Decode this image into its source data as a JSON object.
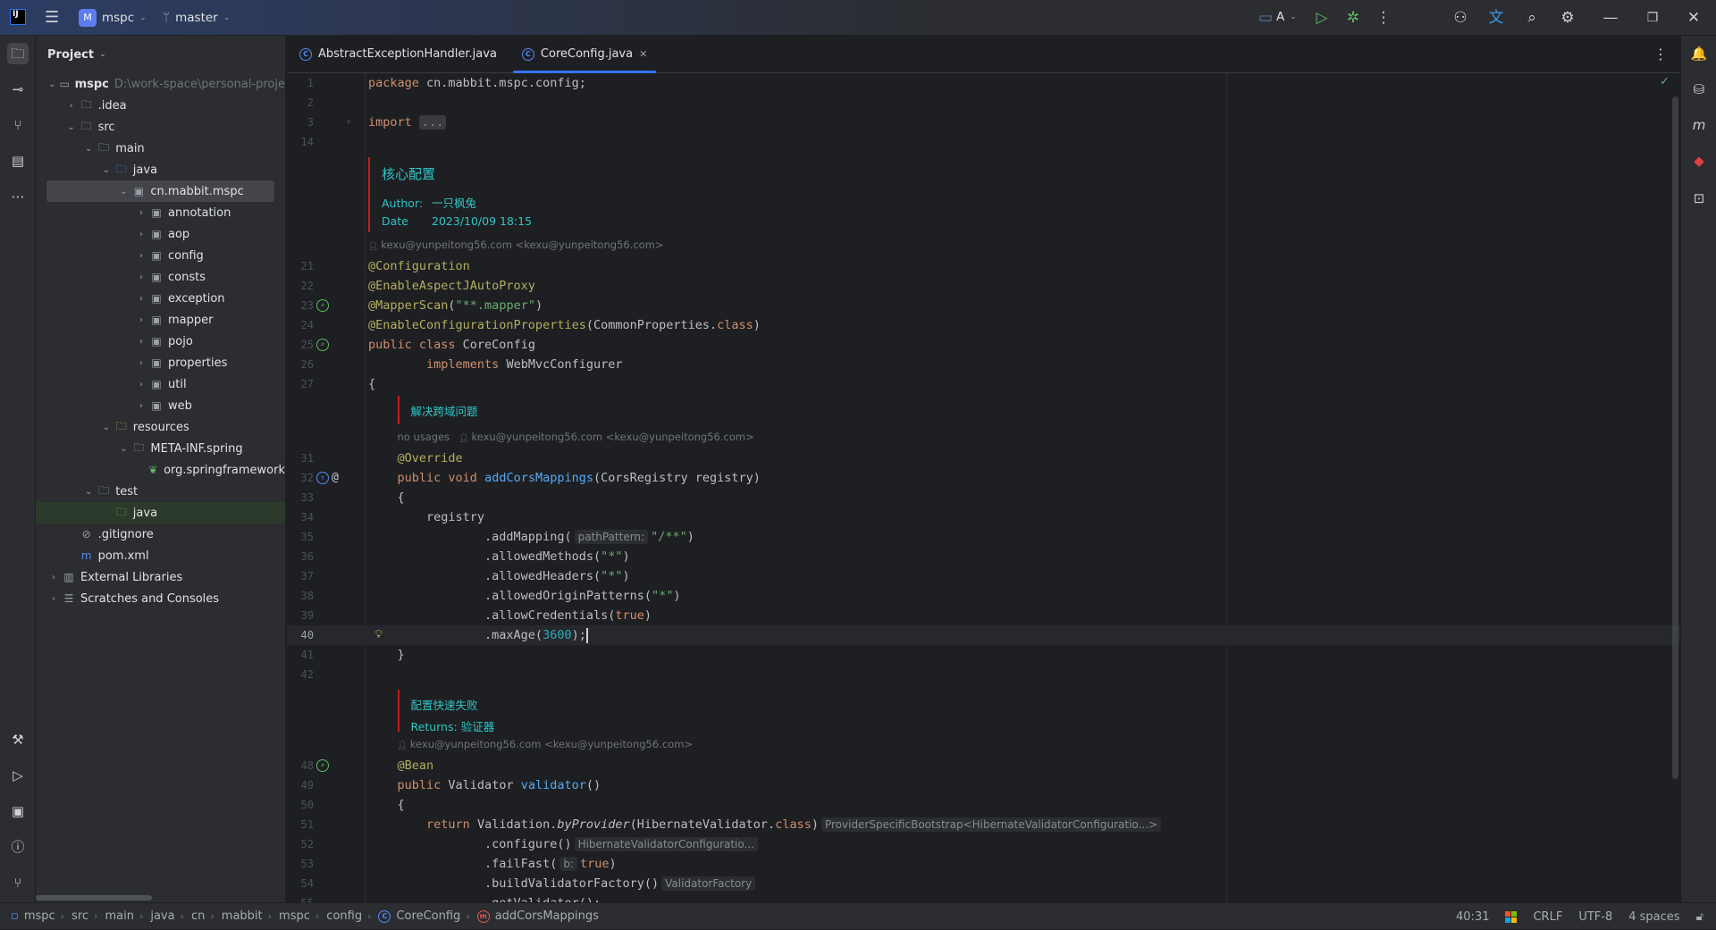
{
  "titlebar": {
    "project": "mspc",
    "project_badge": "M",
    "branch": "master",
    "run_config": "A"
  },
  "project_panel": {
    "title": "Project",
    "tree": [
      {
        "label": "mspc",
        "path": "D:\\work-space\\personal-proje",
        "level": 0,
        "arrow": "down",
        "icon": "module-folder-icon"
      },
      {
        "label": ".idea",
        "level": 1,
        "arrow": "right",
        "icon": "folder-icon"
      },
      {
        "label": "src",
        "level": 1,
        "arrow": "down",
        "icon": "folder-icon"
      },
      {
        "label": "main",
        "level": 2,
        "arrow": "down",
        "icon": "folder-icon"
      },
      {
        "label": "java",
        "level": 3,
        "arrow": "down",
        "icon": "source-folder-icon"
      },
      {
        "label": "cn.mabbit.mspc",
        "level": 4,
        "arrow": "down",
        "icon": "package-icon",
        "selected": true
      },
      {
        "label": "annotation",
        "level": 5,
        "arrow": "right",
        "icon": "package-icon"
      },
      {
        "label": "aop",
        "level": 5,
        "arrow": "right",
        "icon": "package-icon"
      },
      {
        "label": "config",
        "level": 5,
        "arrow": "right",
        "icon": "package-icon"
      },
      {
        "label": "consts",
        "level": 5,
        "arrow": "right",
        "icon": "package-icon"
      },
      {
        "label": "exception",
        "level": 5,
        "arrow": "right",
        "icon": "package-icon"
      },
      {
        "label": "mapper",
        "level": 5,
        "arrow": "right",
        "icon": "package-icon"
      },
      {
        "label": "pojo",
        "level": 5,
        "arrow": "right",
        "icon": "package-icon"
      },
      {
        "label": "properties",
        "level": 5,
        "arrow": "right",
        "icon": "package-icon"
      },
      {
        "label": "util",
        "level": 5,
        "arrow": "right",
        "icon": "package-icon"
      },
      {
        "label": "web",
        "level": 5,
        "arrow": "right",
        "icon": "package-icon"
      },
      {
        "label": "resources",
        "level": 3,
        "arrow": "down",
        "icon": "resources-folder-icon"
      },
      {
        "label": "META-INF.spring",
        "level": 4,
        "arrow": "down",
        "icon": "folder-icon"
      },
      {
        "label": "org.springframework",
        "level": 5,
        "arrow": "",
        "icon": "spring-file-icon"
      },
      {
        "label": "test",
        "level": 2,
        "arrow": "down",
        "icon": "folder-icon"
      },
      {
        "label": "java",
        "level": 3,
        "arrow": "",
        "icon": "test-folder-icon",
        "green": true
      },
      {
        "label": ".gitignore",
        "level": 1,
        "arrow": "",
        "icon": "ignore-file-icon"
      },
      {
        "label": "pom.xml",
        "level": 1,
        "arrow": "",
        "icon": "maven-icon"
      },
      {
        "label": "External Libraries",
        "level": 0,
        "arrow": "right",
        "icon": "library-icon"
      },
      {
        "label": "Scratches and Consoles",
        "level": 0,
        "arrow": "right",
        "icon": "scratches-icon"
      }
    ]
  },
  "tabs": [
    {
      "label": "AbstractExceptionHandler.java",
      "active": false
    },
    {
      "label": "CoreConfig.java",
      "active": true
    }
  ],
  "editor": {
    "rows": [
      {
        "type": "code",
        "n": "1",
        "tokens": [
          [
            "k",
            "package"
          ],
          [
            "t",
            " cn.mabbit.mspc.config;"
          ]
        ]
      },
      {
        "type": "code",
        "n": "2",
        "tokens": []
      },
      {
        "type": "code",
        "n": "3",
        "fold": true,
        "tokens": [
          [
            "k",
            "import "
          ],
          [
            "fold",
            "..."
          ]
        ]
      },
      {
        "type": "code",
        "n": "14",
        "tokens": []
      },
      {
        "type": "doc",
        "indent": 0,
        "height": 92,
        "title": "核心配置",
        "lines": [
          [
            "Author:",
            "一只枫兔"
          ],
          [
            "Date",
            "2023/10/09 18:15"
          ]
        ]
      },
      {
        "type": "hint",
        "indent": 0,
        "usages": "",
        "author": "kexu@yunpeitong56.com <kexu@yunpeitong56.com>"
      },
      {
        "type": "code",
        "n": "21",
        "tokens": [
          [
            "a",
            "@Configuration"
          ]
        ]
      },
      {
        "type": "code",
        "n": "22",
        "tokens": [
          [
            "a",
            "@EnableAspectJAutoProxy"
          ]
        ]
      },
      {
        "type": "code",
        "n": "23",
        "gicon": "bean-search-icon",
        "tokens": [
          [
            "a",
            "@MapperScan"
          ],
          [
            "t",
            "("
          ],
          [
            "s",
            "\"**.mapper\""
          ],
          [
            "t",
            ")"
          ]
        ]
      },
      {
        "type": "code",
        "n": "24",
        "tokens": [
          [
            "a",
            "@EnableConfigurationProperties"
          ],
          [
            "t",
            "(CommonProperties."
          ],
          [
            "k",
            "class"
          ],
          [
            "t",
            ")"
          ]
        ]
      },
      {
        "type": "code",
        "n": "25",
        "gicon": "bean-icon",
        "tokens": [
          [
            "k",
            "public class "
          ],
          [
            "t",
            "CoreConfig"
          ]
        ]
      },
      {
        "type": "code",
        "n": "26",
        "tokens": [
          [
            "t",
            "        "
          ],
          [
            "k",
            "implements "
          ],
          [
            "t",
            "WebMvcConfigurer"
          ]
        ]
      },
      {
        "type": "code",
        "n": "27",
        "tokens": [
          [
            "t",
            "{"
          ]
        ]
      },
      {
        "type": "doc",
        "indent": 1,
        "height": 36,
        "title": "解决跨域问题",
        "lines": []
      },
      {
        "type": "hint",
        "indent": 1,
        "usages": "no usages",
        "author": "kexu@yunpeitong56.com <kexu@yunpeitong56.com>"
      },
      {
        "type": "code",
        "n": "31",
        "tokens": [
          [
            "t",
            "    "
          ],
          [
            "a",
            "@Override"
          ]
        ]
      },
      {
        "type": "code",
        "n": "32",
        "gicon": "override-icon",
        "gicon2": "@",
        "tokens": [
          [
            "t",
            "    "
          ],
          [
            "k",
            "public void "
          ],
          [
            "f",
            "addCorsMappings"
          ],
          [
            "t",
            "(CorsRegistry registry)"
          ]
        ]
      },
      {
        "type": "code",
        "n": "33",
        "tokens": [
          [
            "t",
            "    {"
          ]
        ]
      },
      {
        "type": "code",
        "n": "34",
        "tokens": [
          [
            "t",
            "        registry"
          ]
        ]
      },
      {
        "type": "code",
        "n": "35",
        "tokens": [
          [
            "t",
            "                .addMapping("
          ],
          [
            "h",
            "pathPattern:"
          ],
          [
            "s",
            "\"/**\""
          ],
          [
            "t",
            ")"
          ]
        ]
      },
      {
        "type": "code",
        "n": "36",
        "tokens": [
          [
            "t",
            "                .allowedMethods("
          ],
          [
            "s",
            "\"*\""
          ],
          [
            "t",
            ")"
          ]
        ]
      },
      {
        "type": "code",
        "n": "37",
        "tokens": [
          [
            "t",
            "                .allowedHeaders("
          ],
          [
            "s",
            "\"*\""
          ],
          [
            "t",
            ")"
          ]
        ]
      },
      {
        "type": "code",
        "n": "38",
        "tokens": [
          [
            "t",
            "                .allowedOriginPatterns("
          ],
          [
            "s",
            "\"*\""
          ],
          [
            "t",
            ")"
          ]
        ]
      },
      {
        "type": "code",
        "n": "39",
        "tokens": [
          [
            "t",
            "                .allowCredentials("
          ],
          [
            "k",
            "true"
          ],
          [
            "t",
            ")"
          ]
        ]
      },
      {
        "type": "code",
        "n": "40",
        "current": true,
        "bulb": true,
        "tokens": [
          [
            "t",
            "                .maxAge("
          ],
          [
            "n",
            "3600"
          ],
          [
            "t",
            ");"
          ]
        ]
      },
      {
        "type": "code",
        "n": "41",
        "tokens": [
          [
            "t",
            "    }"
          ]
        ]
      },
      {
        "type": "code",
        "n": "42",
        "tokens": []
      },
      {
        "type": "doc",
        "indent": 1,
        "height": 55,
        "title": "配置快速失败",
        "lines": [
          [
            "Returns:",
            "验证器"
          ]
        ]
      },
      {
        "type": "hint",
        "indent": 1,
        "usages": "",
        "author": "kexu@yunpeitong56.com <kexu@yunpeitong56.com>"
      },
      {
        "type": "code",
        "n": "48",
        "gicon": "bean-icon",
        "tokens": [
          [
            "t",
            "    "
          ],
          [
            "a",
            "@Bean"
          ]
        ]
      },
      {
        "type": "code",
        "n": "49",
        "tokens": [
          [
            "t",
            "    "
          ],
          [
            "k",
            "public "
          ],
          [
            "t",
            "Validator "
          ],
          [
            "f",
            "validator"
          ],
          [
            "t",
            "()"
          ]
        ]
      },
      {
        "type": "code",
        "n": "50",
        "tokens": [
          [
            "t",
            "    {"
          ]
        ]
      },
      {
        "type": "code",
        "n": "51",
        "tokens": [
          [
            "t",
            "        "
          ],
          [
            "k",
            "return "
          ],
          [
            "t",
            "Validation."
          ],
          [
            "i",
            "byProvider"
          ],
          [
            "t",
            "(HibernateValidator."
          ],
          [
            "k",
            "class"
          ],
          [
            "t",
            ")"
          ],
          [
            "h",
            "ProviderSpecificBootstrap<HibernateValidatorConfiguratio...>"
          ]
        ]
      },
      {
        "type": "code",
        "n": "52",
        "tokens": [
          [
            "t",
            "                .configure()"
          ],
          [
            "h",
            "HibernateValidatorConfiguratio..."
          ]
        ]
      },
      {
        "type": "code",
        "n": "53",
        "tokens": [
          [
            "t",
            "                .failFast("
          ],
          [
            "h",
            "b:"
          ],
          [
            "k",
            "true"
          ],
          [
            "t",
            ")"
          ]
        ]
      },
      {
        "type": "code",
        "n": "54",
        "tokens": [
          [
            "t",
            "                .buildValidatorFactory()"
          ],
          [
            "h",
            "ValidatorFactory"
          ]
        ]
      },
      {
        "type": "code",
        "n": "55",
        "tokens": [
          [
            "t",
            "                .getValidator();"
          ]
        ]
      }
    ]
  },
  "breadcrumbs": [
    "mspc",
    "src",
    "main",
    "java",
    "cn",
    "mabbit",
    "mspc",
    "config",
    "CoreConfig",
    "addCorsMappings"
  ],
  "status": {
    "position": "40:31",
    "line_ending": "CRLF",
    "encoding": "UTF-8",
    "indent": "4 spaces"
  },
  "colors": {
    "accent": "#3574f0",
    "keyword": "#cf8e6d",
    "annotation": "#b3ae60",
    "string": "#6aab73",
    "number": "#2aacb8",
    "doc": "#2fc5c5"
  }
}
